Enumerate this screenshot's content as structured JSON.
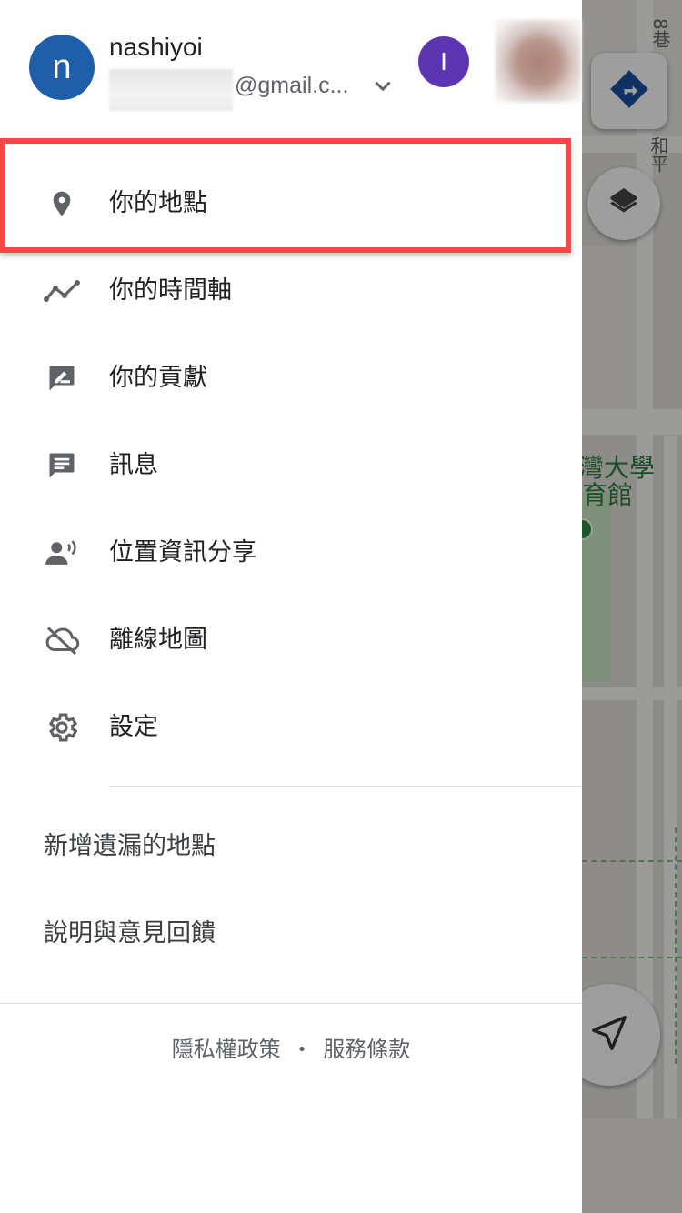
{
  "account": {
    "initial": "n",
    "name": "nashiyoi",
    "email_domain": "@gmail.c...",
    "second_account_initial": "I"
  },
  "menu": {
    "items": [
      {
        "label": "你的地點",
        "icon": "place-pin-icon",
        "highlighted": true
      },
      {
        "label": "你的時間軸",
        "icon": "timeline-icon"
      },
      {
        "label": "你的貢獻",
        "icon": "contribution-icon"
      },
      {
        "label": "訊息",
        "icon": "message-icon"
      },
      {
        "label": "位置資訊分享",
        "icon": "location-sharing-icon"
      },
      {
        "label": "離線地圖",
        "icon": "offline-cloud-icon"
      },
      {
        "label": "設定",
        "icon": "settings-gear-icon"
      }
    ],
    "secondary": [
      {
        "label": "新增遺漏的地點"
      },
      {
        "label": "說明與意見回饋"
      }
    ]
  },
  "footer": {
    "privacy": "隱私權政策",
    "separator": "•",
    "terms": "服務條款"
  },
  "map": {
    "labels": {
      "place_line1": "灣大學",
      "place_line2": "育館",
      "street_top": "8巷",
      "street_right": "和平"
    },
    "icons": [
      "directions-icon",
      "layers-icon",
      "my-location-icon"
    ]
  },
  "colors": {
    "highlight_border": "#f44747",
    "primary_avatar": "#1f5ea8",
    "second_avatar": "#5e35b1",
    "directions_blue": "#1a4fa0"
  }
}
